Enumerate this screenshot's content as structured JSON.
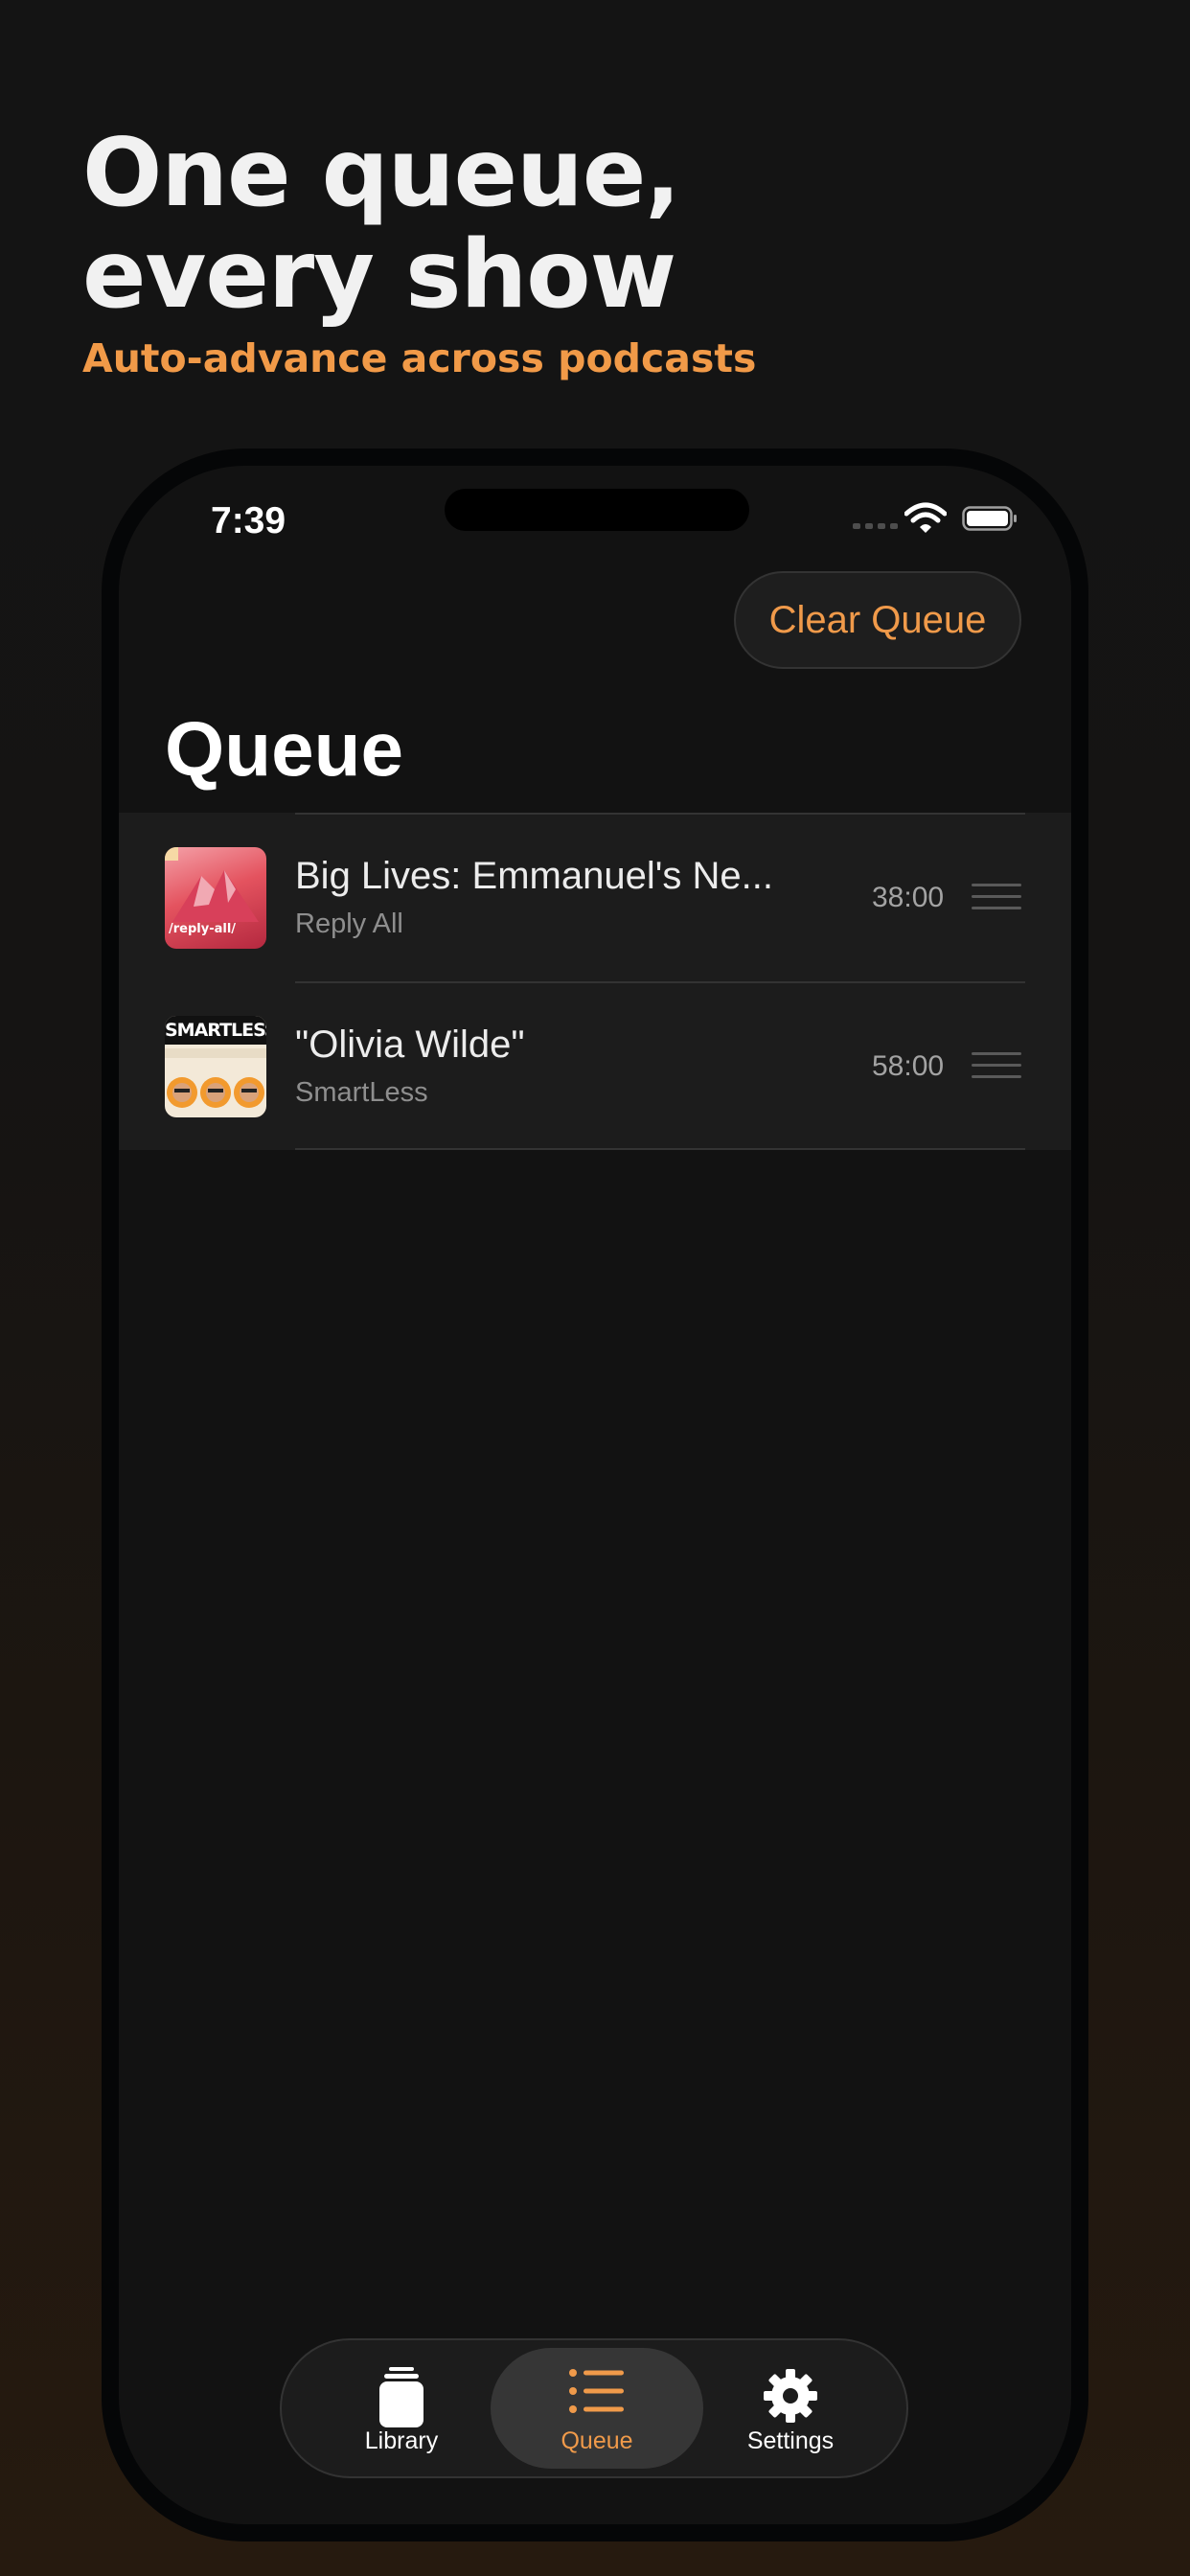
{
  "marketing": {
    "headline_line1": "One queue,",
    "headline_line2": "every show",
    "subheadline": "Auto-advance across podcasts"
  },
  "status_bar": {
    "time": "7:39"
  },
  "toolbar": {
    "clear_queue_label": "Clear Queue"
  },
  "page": {
    "title": "Queue"
  },
  "queue": {
    "items": [
      {
        "title": "Big Lives: Emmanuel's Ne...",
        "show": "Reply All",
        "duration": "38:00",
        "artwork_text": "/reply-all/"
      },
      {
        "title": "\"Olivia Wilde\"",
        "show": "SmartLess",
        "duration": "58:00",
        "artwork_text": "SMARTLESS"
      }
    ]
  },
  "tab_bar": {
    "tabs": [
      {
        "label": "Library",
        "icon": "library-icon",
        "active": false
      },
      {
        "label": "Queue",
        "icon": "list-icon",
        "active": true
      },
      {
        "label": "Settings",
        "icon": "gear-icon",
        "active": false
      }
    ]
  },
  "colors": {
    "accent": "#f09a4a",
    "background": "#121212",
    "row": "#1c1c1c"
  }
}
